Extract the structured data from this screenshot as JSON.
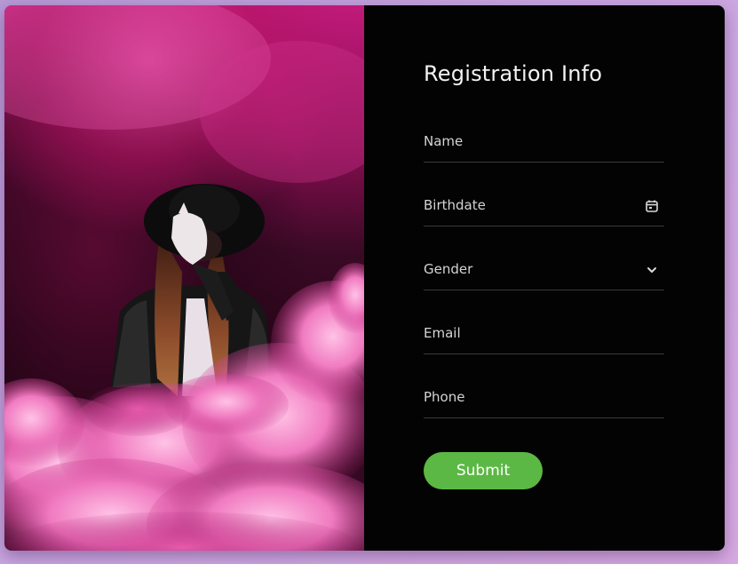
{
  "colors": {
    "background": "#c9a6e0",
    "panel": "#030303",
    "accent": "#5cb844",
    "smoke": "#e04aa0"
  },
  "photo": {
    "description_icon": "person-in-smoke-photo"
  },
  "form": {
    "title": "Registration Info",
    "fields": [
      {
        "label": "Name",
        "icon": ""
      },
      {
        "label": "Birthdate",
        "icon": "calendar-icon"
      },
      {
        "label": "Gender",
        "icon": "chevron-down-icon"
      },
      {
        "label": "Email",
        "icon": ""
      },
      {
        "label": "Phone",
        "icon": ""
      }
    ],
    "submit_label": "Submit"
  }
}
